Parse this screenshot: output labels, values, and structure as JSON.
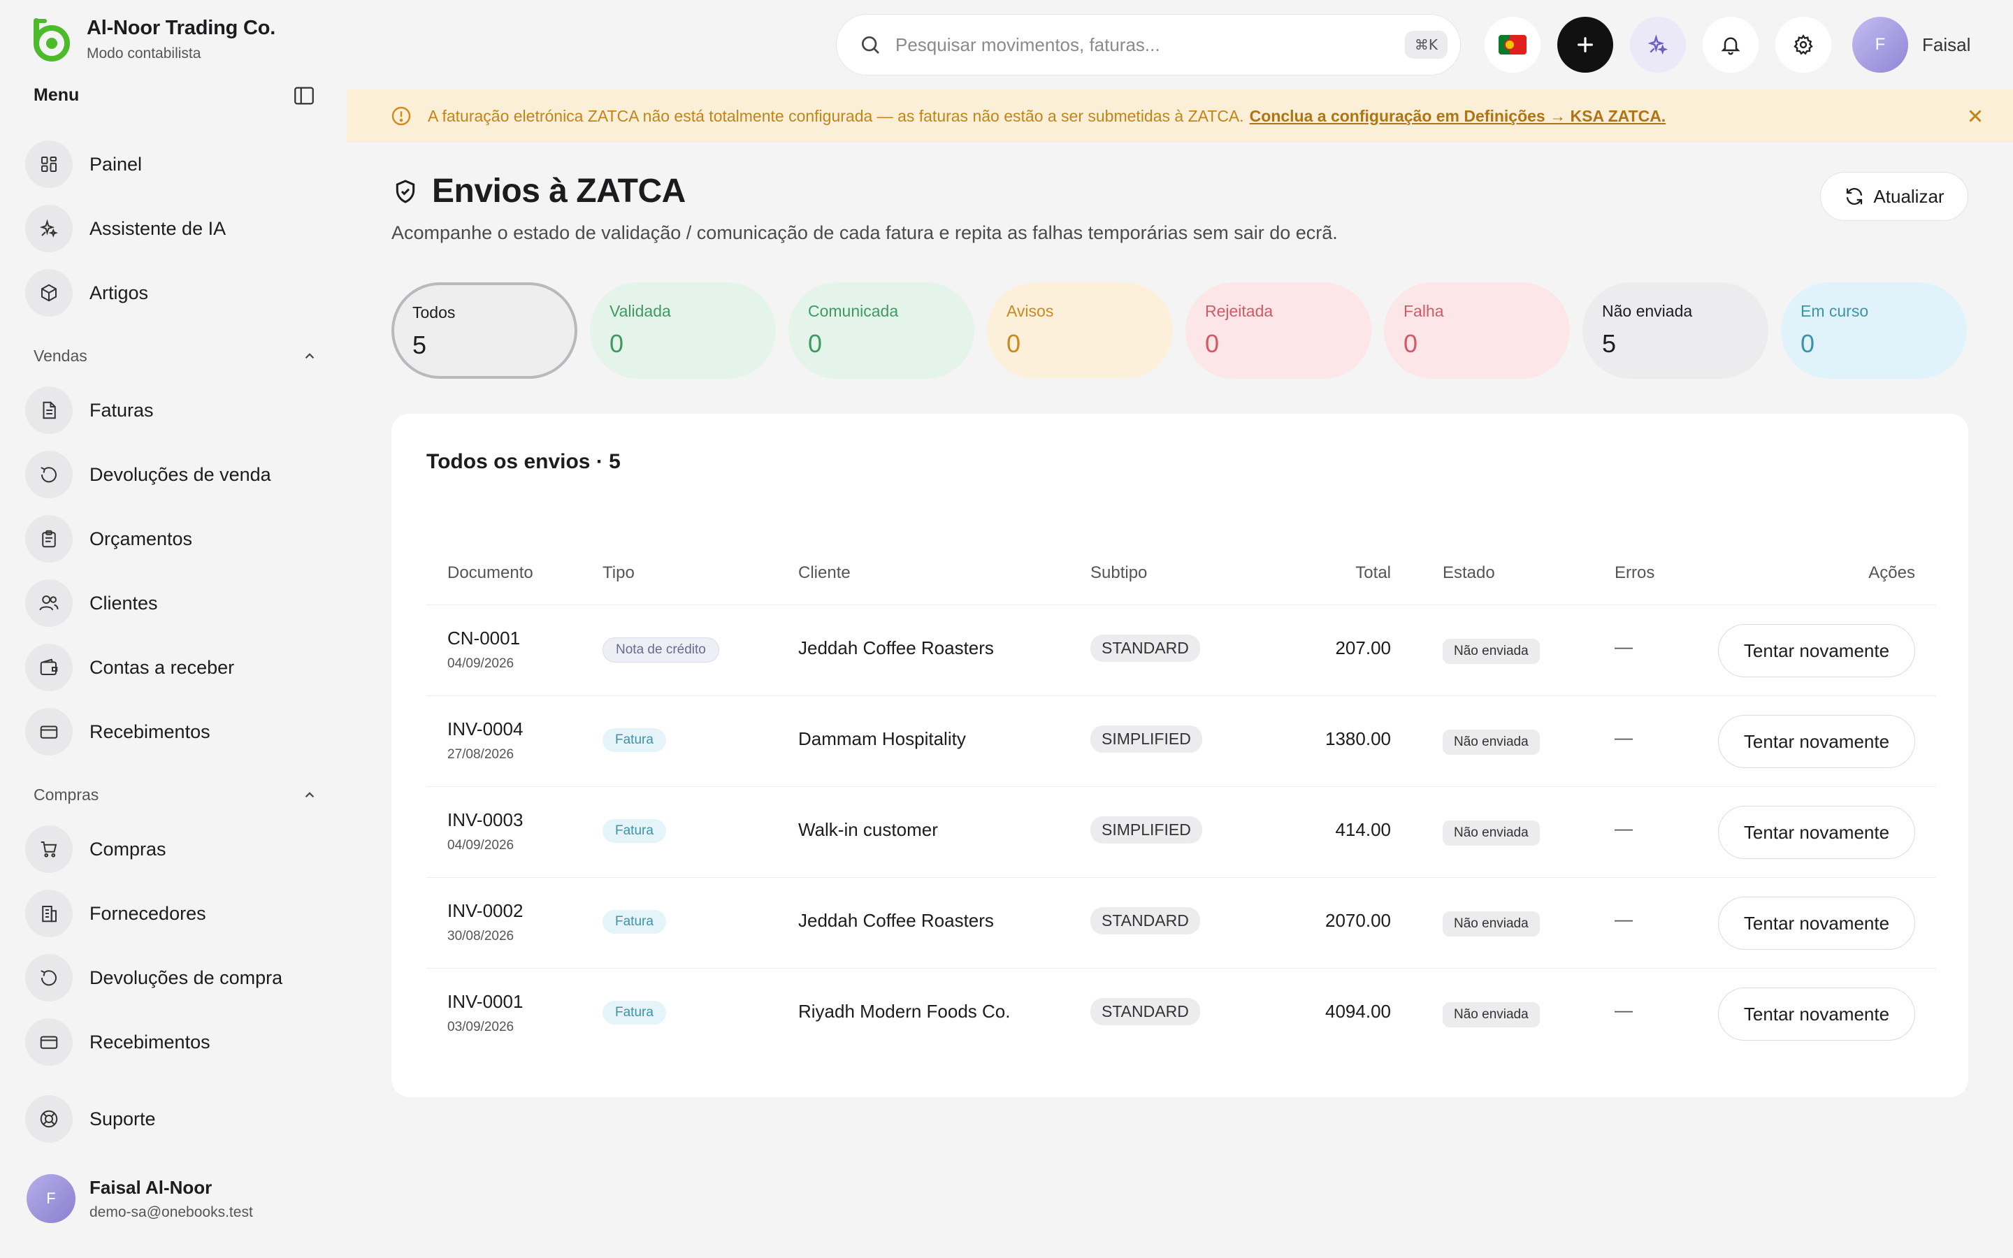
{
  "brand": {
    "name": "Al-Noor Trading Co.",
    "subtitle": "Modo contabilista"
  },
  "sidebar": {
    "menu_label": "Menu",
    "top_items": [
      {
        "label": "Painel",
        "icon": "dashboard-icon"
      },
      {
        "label": "Assistente de IA",
        "icon": "sparkles-icon"
      },
      {
        "label": "Artigos",
        "icon": "package-icon"
      }
    ],
    "sales": {
      "label": "Vendas",
      "items": [
        {
          "label": "Faturas",
          "icon": "document-icon"
        },
        {
          "label": "Devoluções de venda",
          "icon": "undo-icon"
        },
        {
          "label": "Orçamentos",
          "icon": "clipboard-icon"
        },
        {
          "label": "Clientes",
          "icon": "users-icon"
        },
        {
          "label": "Contas a receber",
          "icon": "wallet-icon"
        },
        {
          "label": "Recebimentos",
          "icon": "card-icon"
        }
      ]
    },
    "purchases": {
      "label": "Compras",
      "items": [
        {
          "label": "Compras",
          "icon": "cart-icon"
        },
        {
          "label": "Fornecedores",
          "icon": "building-icon"
        },
        {
          "label": "Devoluções de compra",
          "icon": "undo-icon"
        },
        {
          "label": "Recebimentos",
          "icon": "card-icon"
        }
      ]
    },
    "support_label": "Suporte",
    "user": {
      "initial": "F",
      "name": "Faisal Al-Noor",
      "email": "demo-sa@onebooks.test"
    }
  },
  "topbar": {
    "search_placeholder": "Pesquisar movimentos, faturas...",
    "search_shortcut": "⌘K",
    "profile_initial": "F",
    "profile_name": "Faisal"
  },
  "banner": {
    "text": "A faturação eletrónica ZATCA não está totalmente configurada — as faturas não estão a ser submetidas à ZATCA.",
    "link": "Conclua a configuração em Definições → KSA ZATCA."
  },
  "page": {
    "title": "Envios à ZATCA",
    "subtitle": "Acompanhe o estado de validação / comunicação de cada fatura e repita as falhas temporárias sem sair do ecrã.",
    "refresh_label": "Atualizar"
  },
  "filters": [
    {
      "label": "Todos",
      "count": "5",
      "bg": "#eeeeef",
      "color": "#1c1c1e"
    },
    {
      "label": "Validada",
      "count": "0",
      "bg": "#e4f4ea",
      "color": "#3f9a62"
    },
    {
      "label": "Comunicada",
      "count": "0",
      "bg": "#e4f4ea",
      "color": "#3f9a62"
    },
    {
      "label": "Avisos",
      "count": "0",
      "bg": "#fcf0da",
      "color": "#c98a20"
    },
    {
      "label": "Rejeitada",
      "count": "0",
      "bg": "#fce6e8",
      "color": "#d25a66"
    },
    {
      "label": "Falha",
      "count": "0",
      "bg": "#fce6e8",
      "color": "#d25a66"
    },
    {
      "label": "Não enviada",
      "count": "5",
      "bg": "#ececee",
      "color": "#1c1c1e"
    },
    {
      "label": "Em curso",
      "count": "0",
      "bg": "#e0f3fa",
      "color": "#3d93a8"
    }
  ],
  "table": {
    "title": "Todos os envios · 5",
    "columns": {
      "document": "Documento",
      "type": "Tipo",
      "client": "Cliente",
      "subtype": "Subtipo",
      "total": "Total",
      "status": "Estado",
      "errors": "Erros",
      "actions": "Ações"
    },
    "rows": [
      {
        "id": "CN-0001",
        "date": "04/09/2026",
        "type": "Nota de crédito",
        "type_kind": "credit",
        "client": "Jeddah Coffee Roasters",
        "subtype": "STANDARD",
        "total": "207.00",
        "status": "Não enviada",
        "errors": "—",
        "action": "Tentar novamente"
      },
      {
        "id": "INV-0004",
        "date": "27/08/2026",
        "type": "Fatura",
        "type_kind": "invoice",
        "client": "Dammam Hospitality",
        "subtype": "SIMPLIFIED",
        "total": "1380.00",
        "status": "Não enviada",
        "errors": "—",
        "action": "Tentar novamente"
      },
      {
        "id": "INV-0003",
        "date": "04/09/2026",
        "type": "Fatura",
        "type_kind": "invoice",
        "client": "Walk-in customer",
        "subtype": "SIMPLIFIED",
        "total": "414.00",
        "status": "Não enviada",
        "errors": "—",
        "action": "Tentar novamente"
      },
      {
        "id": "INV-0002",
        "date": "30/08/2026",
        "type": "Fatura",
        "type_kind": "invoice",
        "client": "Jeddah Coffee Roasters",
        "subtype": "STANDARD",
        "total": "2070.00",
        "status": "Não enviada",
        "errors": "—",
        "action": "Tentar novamente"
      },
      {
        "id": "INV-0001",
        "date": "03/09/2026",
        "type": "Fatura",
        "type_kind": "invoice",
        "client": "Riyadh Modern Foods Co.",
        "subtype": "STANDARD",
        "total": "4094.00",
        "status": "Não enviada",
        "errors": "—",
        "action": "Tentar novamente"
      }
    ]
  },
  "colors": {
    "brand_green": "#4cba2a",
    "accent_black": "#111111",
    "warning_text": "#c2841a"
  }
}
